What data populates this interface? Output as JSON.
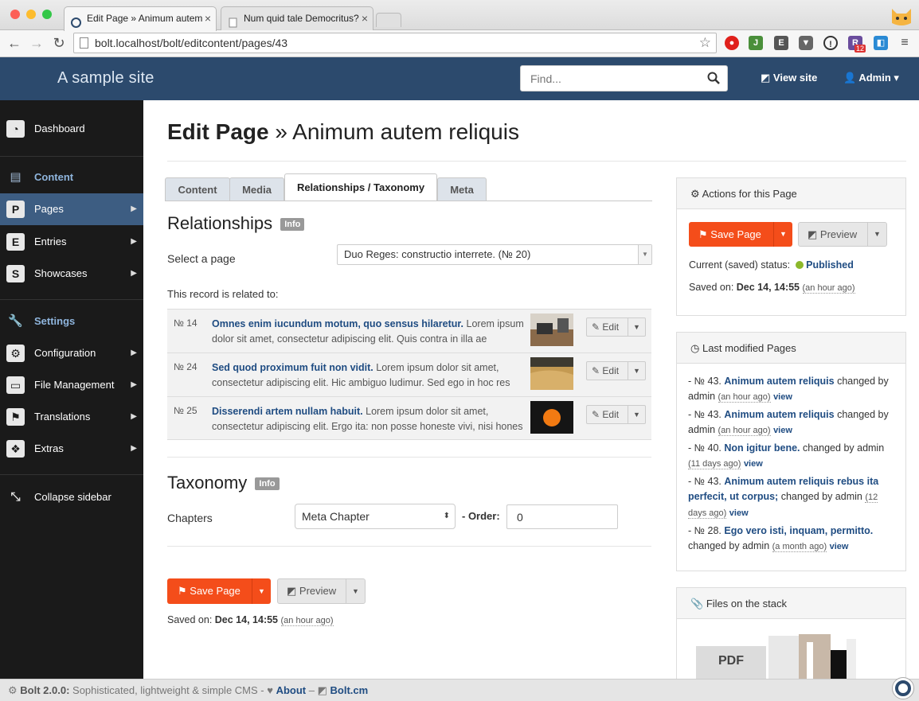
{
  "browser": {
    "tabs": [
      {
        "title": "Edit Page » Animum autem",
        "close": "×"
      },
      {
        "title": "Num quid tale Democritus?",
        "close": "×"
      }
    ],
    "url": "bolt.localhost/bolt/editcontent/pages/43",
    "extension_badge": "12"
  },
  "header": {
    "site_title": "A sample site",
    "search_placeholder": "Find...",
    "view_site": "View site",
    "admin": "Admin"
  },
  "sidebar": {
    "dashboard": "Dashboard",
    "content_heading": "Content",
    "items": [
      {
        "letter": "P",
        "label": "Pages"
      },
      {
        "letter": "E",
        "label": "Entries"
      },
      {
        "letter": "S",
        "label": "Showcases"
      }
    ],
    "settings_heading": "Settings",
    "settings_items": [
      {
        "label": "Configuration"
      },
      {
        "label": "File Management"
      },
      {
        "label": "Translations"
      },
      {
        "label": "Extras"
      }
    ],
    "collapse": "Collapse sidebar"
  },
  "main": {
    "title_bold": "Edit Page",
    "title_rest": "» Animum autem reliquis",
    "tabs": [
      "Content",
      "Media",
      "Relationships / Taxonomy",
      "Meta"
    ],
    "relationships_heading": "Relationships",
    "info_badge": "Info",
    "select_page_label": "Select a page",
    "select_page_value": "Duo Reges: constructio interrete. (№ 20)",
    "related_label": "This record is related to:",
    "related": [
      {
        "num": "№ 14",
        "title": "Omnes enim iucundum motum, quo sensus hilaretur.",
        "excerpt": " Lorem ipsum dolor sit amet, consectetur adipiscing elit. Quis contra in illa ae",
        "edit": "Edit"
      },
      {
        "num": "№ 24",
        "title": "Sed quod proximum fuit non vidit.",
        "excerpt": " Lorem ipsum dolor sit amet, consectetur adipiscing elit. Hic ambiguo ludimur. Sed ego in hoc res",
        "edit": "Edit"
      },
      {
        "num": "№ 25",
        "title": "Disserendi artem nullam habuit.",
        "excerpt": " Lorem ipsum dolor sit amet, consectetur adipiscing elit. Ergo ita: non posse honeste vivi, nisi hones",
        "edit": "Edit"
      }
    ],
    "taxonomy_heading": "Taxonomy",
    "chapters_label": "Chapters",
    "chapters_value": "Meta Chapter",
    "order_label": "- Order:",
    "order_value": "0",
    "save_button": "Save Page",
    "preview_button": "Preview",
    "saved_on_label": "Saved on:",
    "saved_on_value": "Dec 14, 14:55",
    "saved_ago": "(an hour ago)"
  },
  "actions_panel": {
    "heading": "Actions for this Page",
    "save_button": "Save Page",
    "preview_button": "Preview",
    "status_label": "Current (saved) status:",
    "status_value": "Published",
    "status_color": "#8cb82b",
    "saved_on_label": "Saved on:",
    "saved_on_value": "Dec 14, 14:55",
    "saved_ago": "(an hour ago)"
  },
  "last_modified": {
    "heading": "Last modified Pages",
    "items": [
      {
        "prefix": "- № 43.",
        "title": "Animum autem reliquis",
        "tail": " changed by admin ",
        "ago": "(an hour ago)",
        "view": "view"
      },
      {
        "prefix": "- № 43.",
        "title": "Animum autem reliquis",
        "tail": " changed by admin ",
        "ago": "(an hour ago)",
        "view": "view"
      },
      {
        "prefix": "- № 40.",
        "title": "Non igitur bene.",
        "tail": " changed by admin ",
        "ago": "(11 days ago)",
        "view": "view"
      },
      {
        "prefix": "- № 43.",
        "title": "Animum autem reliquis rebus ita perfecit, ut corpus;",
        "tail": " changed by admin ",
        "ago": "(12 days ago)",
        "view": "view"
      },
      {
        "prefix": "- № 28.",
        "title": "Ego vero isti, inquam, permitto.",
        "tail": " changed by admin ",
        "ago": "(a month ago)",
        "view": "view"
      }
    ]
  },
  "stack_panel": {
    "heading": "Files on the stack",
    "pdf_label": "PDF"
  },
  "footer": {
    "version": "Bolt 2.0.0:",
    "tagline": " Sophisticated, lightweight & simple CMS - ",
    "about": "About",
    "dash": " – ",
    "boltcm": "Bolt.cm"
  },
  "colors": {
    "accent": "#f44d1a",
    "header_bg": "#2c4a6d",
    "sidebar_bg": "#1a1a1a",
    "sidebar_active": "#3d5d82",
    "link": "#1f4c82"
  }
}
